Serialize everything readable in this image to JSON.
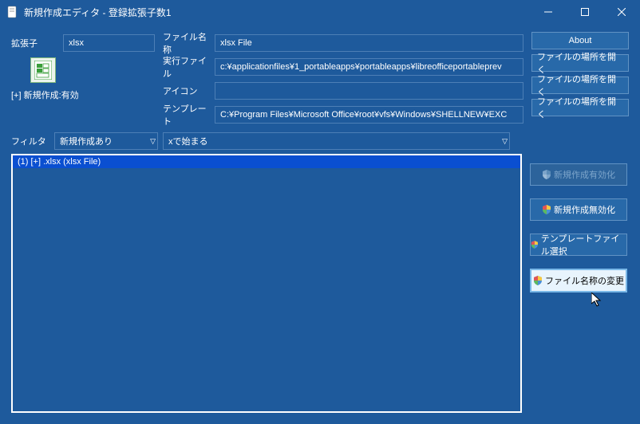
{
  "window": {
    "title": "新規作成エディタ - 登録拡張子数1"
  },
  "labels": {
    "extension": "拡張子",
    "fileName": "ファイル名称",
    "execFile": "実行ファイル",
    "icon": "アイコン",
    "template": "テンプレート",
    "newCreateEnable": "[+] 新規作成:有効",
    "filter": "フィルタ"
  },
  "values": {
    "extension": "xlsx",
    "fileName": "xlsx File",
    "execFile": "c:¥applicationfiles¥1_portableapps¥portableapps¥libreofficeportableprev",
    "icon": "",
    "template": "C:¥Program Files¥Microsoft Office¥root¥vfs¥Windows¥SHELLNEW¥EXC"
  },
  "buttons": {
    "about": "About",
    "openFileLocation": "ファイルの場所を開く",
    "enableNewCreate": "新規作成有効化",
    "disableNewCreate": "新規作成無効化",
    "selectTemplateFile": "テンプレートファイル選択",
    "changeFileName": "ファイル名称の変更"
  },
  "filter": {
    "dd1": "新規作成あり",
    "dd2": "xで始まる"
  },
  "list": {
    "item1": "(1) [+] .xlsx   (xlsx File)"
  }
}
